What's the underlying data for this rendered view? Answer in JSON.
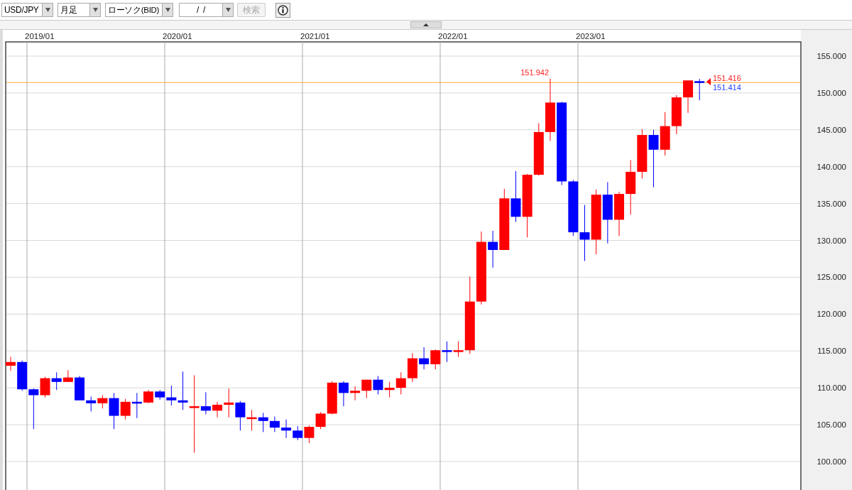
{
  "toolbar": {
    "currency": {
      "value": "USD/JPY"
    },
    "period": {
      "value": "月足"
    },
    "chart_type": {
      "value": "ローソク(BID)"
    },
    "date": {
      "value": "/  /"
    },
    "search_button": {
      "label": "検索",
      "disabled": true
    }
  },
  "chart": {
    "x_labels": [
      "2019/01",
      "2020/01",
      "2021/01",
      "2022/01",
      "2023/01"
    ],
    "y_labels": [
      "155.000",
      "150.000",
      "145.000",
      "140.000",
      "135.000",
      "130.000",
      "125.000",
      "120.000",
      "115.000",
      "110.000",
      "105.000",
      "100.000"
    ],
    "high_label": "151.942",
    "ask_label": "151.416",
    "bid_label": "151.414"
  }
}
